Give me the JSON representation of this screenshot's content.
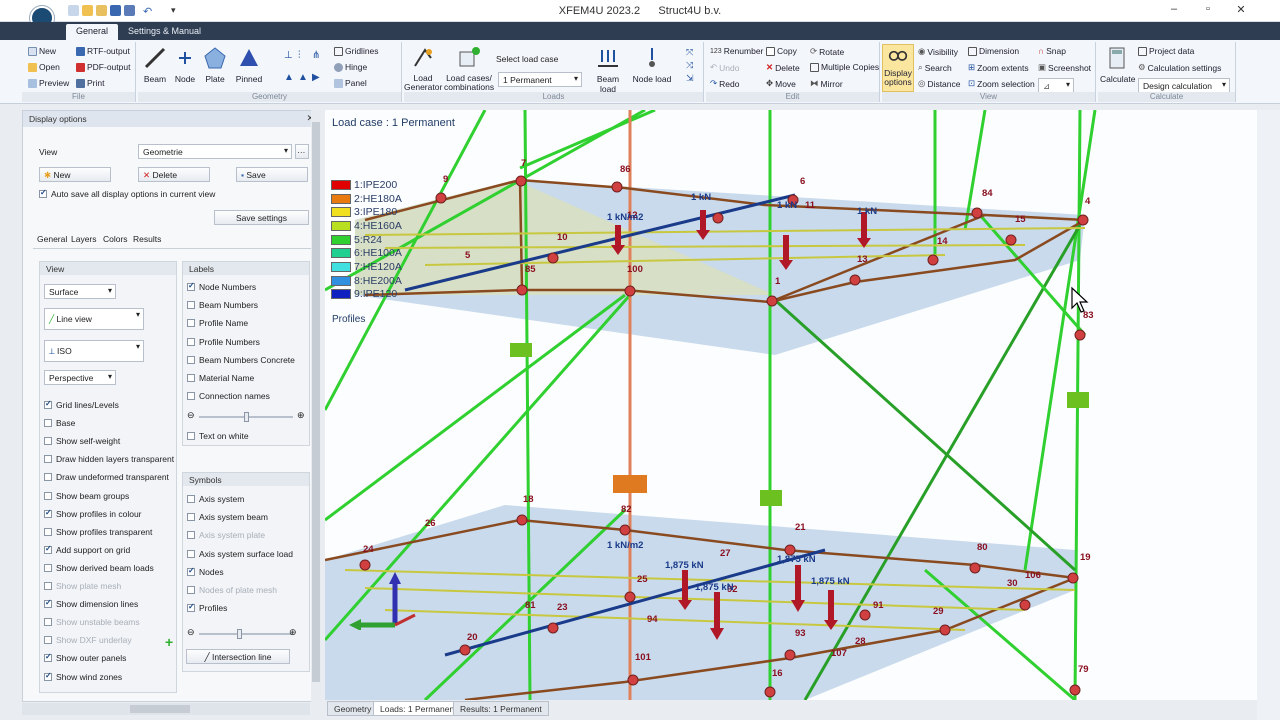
{
  "window": {
    "title": "XFEM4U 2023.2      Struct4U b.v."
  },
  "tabs": [
    "General",
    "Settings & Manual"
  ],
  "ribbon": {
    "file": {
      "name": "File",
      "items": [
        "New",
        "Open",
        "Preview",
        "RTF-output",
        "PDF-output",
        "Print"
      ]
    },
    "geometry": {
      "name": "Geometry",
      "big": [
        "Beam",
        "Node",
        "Plate",
        "Pinned"
      ],
      "small": [
        "Gridlines",
        "Hinge",
        "Panel"
      ]
    },
    "loads": {
      "name": "Loads",
      "big": [
        "Load Generator",
        "Load cases/ combinations",
        "Beam load",
        "Node load"
      ],
      "select_label": "Select load case",
      "select_value": "1 Permanent"
    },
    "edit": {
      "name": "Edit",
      "items": [
        "Renumber",
        "Undo",
        "Redo",
        "Copy",
        "Delete",
        "Move",
        "Rotate",
        "Multiple Copies",
        "Mirror"
      ]
    },
    "view": {
      "name": "View",
      "display": "Display options",
      "items": [
        "Visibility",
        "Search",
        "Distance",
        "Dimension",
        "Zoom extents",
        "Zoom selection",
        "Snap",
        "Screenshot"
      ]
    },
    "calculate": {
      "name": "Calculate",
      "big": "Calculate",
      "items": [
        "Project data",
        "Calculation settings"
      ],
      "select_value": "Design calculation"
    }
  },
  "panel": {
    "title": "Display options",
    "view_label": "View",
    "view_value": "Geometrie",
    "new": "New",
    "delete": "Delete",
    "save": "Save",
    "autosave": "Auto save all display options in current view",
    "save_settings": "Save settings",
    "subtabs": [
      "General",
      "Layers",
      "Colors",
      "Results"
    ],
    "view_box": {
      "header": "View",
      "surface": "Surface",
      "line_view": "Line view",
      "iso": "ISO",
      "perspective": "Perspective"
    },
    "view_checks": [
      {
        "label": "Grid lines/Levels",
        "on": true,
        "dis": false
      },
      {
        "label": "Base",
        "on": false,
        "dis": false
      },
      {
        "label": "Show self-weight",
        "on": false,
        "dis": false
      },
      {
        "label": "Draw hidden layers transparent",
        "on": false,
        "dis": false
      },
      {
        "label": "Draw undeformed transparent",
        "on": false,
        "dis": false
      },
      {
        "label": "Show beam groups",
        "on": false,
        "dis": false
      },
      {
        "label": "Show profiles in colour",
        "on": true,
        "dis": false
      },
      {
        "label": "Show profiles transparent",
        "on": false,
        "dis": false
      },
      {
        "label": "Add support on grid",
        "on": true,
        "dis": false
      },
      {
        "label": "Show derived beam loads",
        "on": false,
        "dis": false
      },
      {
        "label": "Show plate mesh",
        "on": false,
        "dis": true
      },
      {
        "label": "Show dimension lines",
        "on": true,
        "dis": false
      },
      {
        "label": "Show unstable beams",
        "on": false,
        "dis": true
      },
      {
        "label": "Show DXF underlay",
        "on": false,
        "dis": true
      },
      {
        "label": "Show outer panels",
        "on": true,
        "dis": false
      },
      {
        "label": "Show wind zones",
        "on": true,
        "dis": false
      }
    ],
    "labels_box": {
      "header": "Labels"
    },
    "label_checks": [
      {
        "label": "Node Numbers",
        "on": true
      },
      {
        "label": "Beam Numbers",
        "on": false
      },
      {
        "label": "Profile Name",
        "on": false
      },
      {
        "label": "Profile Numbers",
        "on": false
      },
      {
        "label": "Beam Numbers Concrete",
        "on": false
      },
      {
        "label": "Material Name",
        "on": false
      },
      {
        "label": "Connection names",
        "on": false
      }
    ],
    "text_on_white": "Text on white",
    "symbols_box": {
      "header": "Symbols"
    },
    "symbol_checks": [
      {
        "label": "Axis system",
        "on": false,
        "dis": false
      },
      {
        "label": "Axis system beam",
        "on": false,
        "dis": false
      },
      {
        "label": "Axis system plate",
        "on": false,
        "dis": true
      },
      {
        "label": "Axis system surface load",
        "on": false,
        "dis": false
      },
      {
        "label": "Nodes",
        "on": true,
        "dis": false
      },
      {
        "label": "Nodes of plate mesh",
        "on": false,
        "dis": true
      },
      {
        "label": "Profiles",
        "on": true,
        "dis": false
      }
    ],
    "intersection_line": "Intersection line"
  },
  "viewport": {
    "caption": "Load case : 1 Permanent",
    "profiles_label": "Profiles",
    "legend": [
      {
        "label": "1:IPE200",
        "color": "#e00000"
      },
      {
        "label": "2:HE180A",
        "color": "#e87a10"
      },
      {
        "label": "3:IPE180",
        "color": "#f0e020"
      },
      {
        "label": "4:HE160A",
        "color": "#b8e020"
      },
      {
        "label": "5:R24",
        "color": "#30d030"
      },
      {
        "label": "6:HE100A",
        "color": "#20d090"
      },
      {
        "label": "7:HE120A",
        "color": "#40e0e0"
      },
      {
        "label": "8:HE200A",
        "color": "#3090e0"
      },
      {
        "label": "9:IPE120",
        "color": "#1020c0"
      }
    ],
    "node_labels": [
      "9",
      "7",
      "86",
      "6",
      "11",
      "84",
      "4",
      "15",
      "12",
      "10",
      "5",
      "85",
      "100",
      "1",
      "13",
      "14",
      "83",
      "26",
      "18",
      "82",
      "21",
      "24",
      "27",
      "80",
      "19",
      "30",
      "106",
      "25",
      "23",
      "92",
      "94",
      "91",
      "29",
      "28",
      "93",
      "107",
      "20",
      "101",
      "16",
      "79",
      "81"
    ],
    "load_labels": [
      "1 kN/m2",
      "1 kN",
      "1 kN",
      "1 kN",
      "1 kN/m2",
      "1,875 kN",
      "1,875 kN",
      "1,875 kN",
      "1,875 kN"
    ]
  },
  "bottom_tabs": [
    "Geometry",
    "Loads: 1 Permanent",
    "Results: 1 Permanent"
  ]
}
